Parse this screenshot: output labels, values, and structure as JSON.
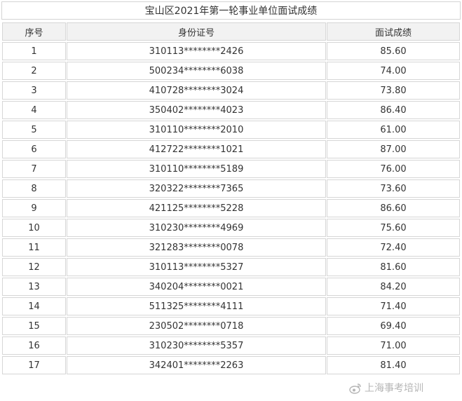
{
  "title": "宝山区2021年第一轮事业单位面试成绩",
  "headers": {
    "seq": "序号",
    "id": "身份证号",
    "score": "面试成绩"
  },
  "rows": [
    {
      "seq": "1",
      "id": "310113********2426",
      "score": "85.60"
    },
    {
      "seq": "2",
      "id": "500234********6038",
      "score": "74.00"
    },
    {
      "seq": "3",
      "id": "410728********3024",
      "score": "73.80"
    },
    {
      "seq": "4",
      "id": "350402********4023",
      "score": "86.40"
    },
    {
      "seq": "5",
      "id": "310110********2010",
      "score": "61.00"
    },
    {
      "seq": "6",
      "id": "412722********1021",
      "score": "87.00"
    },
    {
      "seq": "7",
      "id": "310110********5189",
      "score": "76.00"
    },
    {
      "seq": "8",
      "id": "320322********7365",
      "score": "73.60"
    },
    {
      "seq": "9",
      "id": "421125********5228",
      "score": "86.60"
    },
    {
      "seq": "10",
      "id": "310230********4969",
      "score": "75.60"
    },
    {
      "seq": "11",
      "id": "321283********0078",
      "score": "72.40"
    },
    {
      "seq": "12",
      "id": "310113********5327",
      "score": "81.60"
    },
    {
      "seq": "13",
      "id": "340204********0021",
      "score": "84.20"
    },
    {
      "seq": "14",
      "id": "511325********4111",
      "score": "71.40"
    },
    {
      "seq": "15",
      "id": "230502********0718",
      "score": "69.40"
    },
    {
      "seq": "16",
      "id": "310230********5357",
      "score": "71.00"
    },
    {
      "seq": "17",
      "id": "342401********2263",
      "score": "81.40"
    }
  ],
  "watermark": {
    "text": "上海事考培训",
    "icon": "weibo-icon"
  }
}
